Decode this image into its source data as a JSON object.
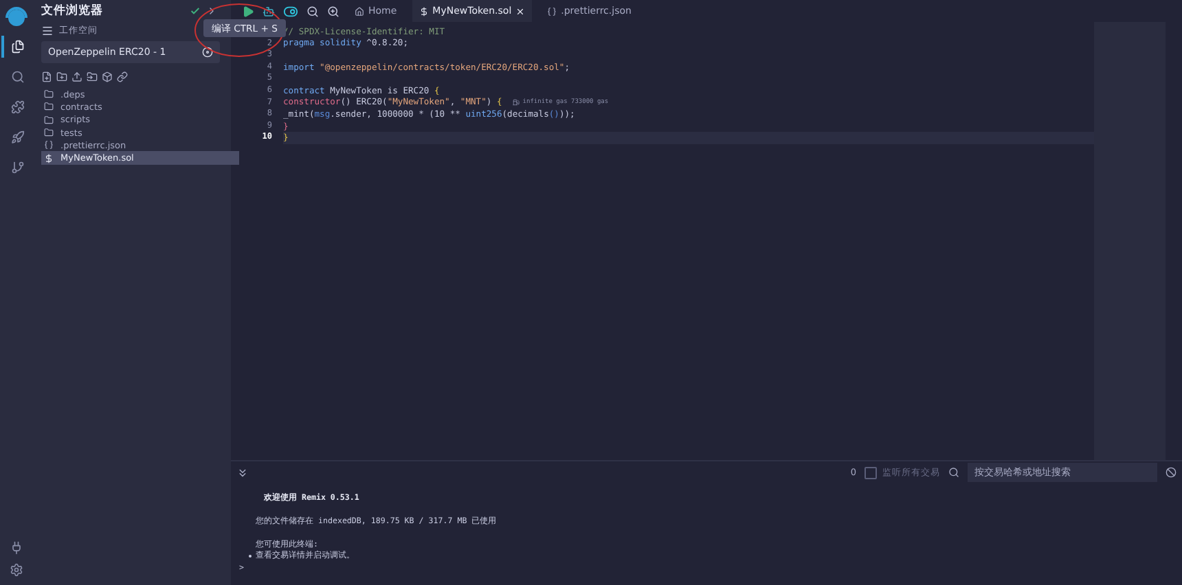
{
  "rail": {
    "items": [
      {
        "selected": true
      },
      {
        "selected": false
      },
      {
        "selected": false
      },
      {
        "selected": false
      },
      {
        "selected": false
      }
    ]
  },
  "sidebar": {
    "title": "文件浏览器",
    "workspace_label": "工作空间",
    "workspace": "OpenZeppelin ERC20 - 1",
    "files": [
      {
        "name": ".deps",
        "kind": "folder",
        "selected": false
      },
      {
        "name": "contracts",
        "kind": "folder",
        "selected": false
      },
      {
        "name": "scripts",
        "kind": "folder",
        "selected": false
      },
      {
        "name": "tests",
        "kind": "folder",
        "selected": false
      },
      {
        "name": ".prettierrc.json",
        "kind": "json",
        "selected": false
      },
      {
        "name": "MyNewToken.sol",
        "kind": "sol",
        "selected": true
      }
    ]
  },
  "tooltip": "编译 CTRL + S",
  "tabs": [
    {
      "label": "Home",
      "kind": "home",
      "selected": false
    },
    {
      "label": "MyNewToken.sol",
      "kind": "sol",
      "selected": true
    },
    {
      "label": ".prettierrc.json",
      "kind": "json",
      "selected": false
    }
  ],
  "editor": {
    "lines": [
      {
        "tokens": [
          {
            "text": "// SPDX-License-Identifier: MIT",
            "kind": "comment"
          }
        ]
      },
      {
        "number": "2",
        "tokens": [
          {
            "text": "pragma solidity",
            "kind": "keyword"
          },
          {
            "text": " ^0.8.20;",
            "kind": "plain"
          }
        ]
      },
      {
        "number": "3"
      },
      {
        "number": "4",
        "tokens": [
          {
            "text": "import",
            "kind": "keyword"
          },
          {
            "text": " \"@openzeppelin/contracts/token/ERC20/ERC20.sol\"",
            "kind": "string"
          },
          {
            "text": ";",
            "kind": "plain"
          }
        ]
      },
      {
        "number": "5"
      },
      {
        "number": "6",
        "tokens": [
          {
            "text": "contract",
            "kind": "keyword"
          },
          {
            "text": " MyNewToken is ERC20 ",
            "kind": "plain"
          },
          {
            "text": "{",
            "kind": "brace"
          }
        ]
      },
      {
        "number": "7",
        "tokens": [
          {
            "text": "constructor",
            "kind": "func"
          },
          {
            "text": "() ERC20(",
            "kind": "plain"
          },
          {
            "text": "\"MyNewToken\"",
            "kind": "string"
          },
          {
            "text": ", ",
            "kind": "plain"
          },
          {
            "text": "\"MNT\"",
            "kind": "string"
          },
          {
            "text": ") ",
            "kind": "plain"
          },
          {
            "text": "{",
            "kind": "brace"
          }
        ],
        "hint": "infinite gas 733000 gas"
      },
      {
        "number": "8",
        "tokens": [
          {
            "text": "_mint(",
            "kind": "plain"
          },
          {
            "text": "msg",
            "kind": "builtin"
          },
          {
            "text": ".sender, 1000000 * (10 ** ",
            "kind": "plain"
          },
          {
            "text": "uint256",
            "kind": "keyword"
          },
          {
            "text": "(decimals",
            "kind": "plain"
          },
          {
            "text": "()",
            "kind": "builtin"
          },
          {
            "text": "));",
            "kind": "plain"
          }
        ]
      },
      {
        "number": "9",
        "tokens": [
          {
            "text": "}",
            "kind": "func"
          }
        ]
      },
      {
        "number": "10",
        "tokens": [
          {
            "text": "}",
            "kind": "brace"
          }
        ],
        "current": true
      }
    ]
  },
  "terminal_bar": {
    "count": "0",
    "listen": {
      "label": "监听所有交易",
      "checked": false
    },
    "search": {
      "placeholder": "按交易哈希或地址搜索"
    }
  },
  "terminal": {
    "welcome": "欢迎使用 Remix 0.53.1",
    "storage": "您的文件储存在 indexedDB, 189.75 KB / 317.7 MB 已使用",
    "intro": "您可使用此终端:",
    "bullets": [
      "查看交易详情并启动调试。"
    ],
    "prompt": ">"
  }
}
